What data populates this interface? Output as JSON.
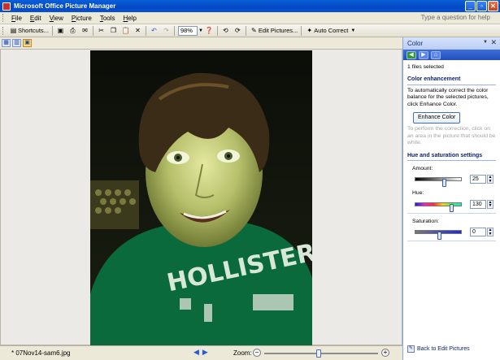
{
  "window": {
    "title": "Microsoft Office Picture Manager"
  },
  "menu": {
    "items": [
      "File",
      "Edit",
      "View",
      "Picture",
      "Tools",
      "Help"
    ],
    "help_placeholder": "Type a question for help"
  },
  "toolbar": {
    "shortcuts_label": "Shortcuts...",
    "zoom_value": "98%",
    "edit_pictures_label": "Edit Pictures...",
    "auto_correct_label": "Auto Correct"
  },
  "status": {
    "filename": "* 07Nov14-sam6.jpg",
    "zoom_label": "Zoom:",
    "zoom_level": 0.48
  },
  "pane": {
    "title": "Color",
    "files_selected": "1 files selected",
    "color_enhancement": {
      "heading": "Color enhancement",
      "instructions": "To automatically correct the color balance for the selected pictures, click Enhance Color.",
      "button": "Enhance Color",
      "hint": "To perform the correction, click on an area in the picture that should be white."
    },
    "hue_saturation": {
      "heading": "Hue and saturation settings",
      "amount": {
        "label": "Amount:",
        "value": "25",
        "level": 0.62
      },
      "hue": {
        "label": "Hue:",
        "value": "130",
        "level": 0.8
      },
      "saturation": {
        "label": "Saturation:",
        "value": "0",
        "level": 0.5
      }
    },
    "back_link": "Back to Edit Pictures"
  },
  "colors": {
    "title_bar": "#0a5fd8",
    "shirt_green": "#0b6a3c",
    "pane_nav": "#3d6fdc"
  }
}
